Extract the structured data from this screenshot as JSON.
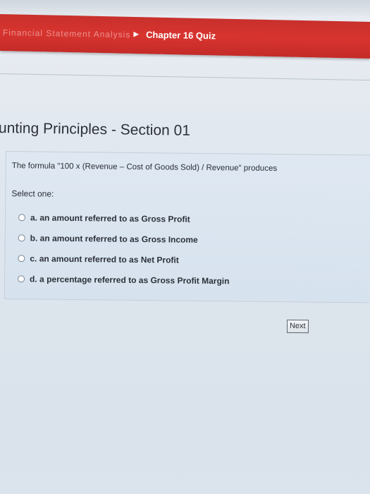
{
  "nav": {
    "breadcrumb_prev": "Financial Statement Analysis",
    "breadcrumb_arrow": "▶",
    "breadcrumb_current": "Chapter 16 Quiz",
    "accent_color": "#d0322e"
  },
  "page": {
    "title": "unting Principles - Section 01"
  },
  "question": {
    "text": "The formula \"100 x (Revenue – Cost of Goods Sold) / Revenue\" produces",
    "select_label": "Select one:",
    "options": [
      {
        "label": "a. an amount referred to as Gross Profit",
        "selected": false
      },
      {
        "label": "b. an amount referred to as Gross Income",
        "selected": false
      },
      {
        "label": "c. an amount referred to as Net Profit",
        "selected": false
      },
      {
        "label": "d. a percentage referred to as Gross Profit Margin",
        "selected": false
      }
    ]
  },
  "footer": {
    "next_label": "Next"
  }
}
